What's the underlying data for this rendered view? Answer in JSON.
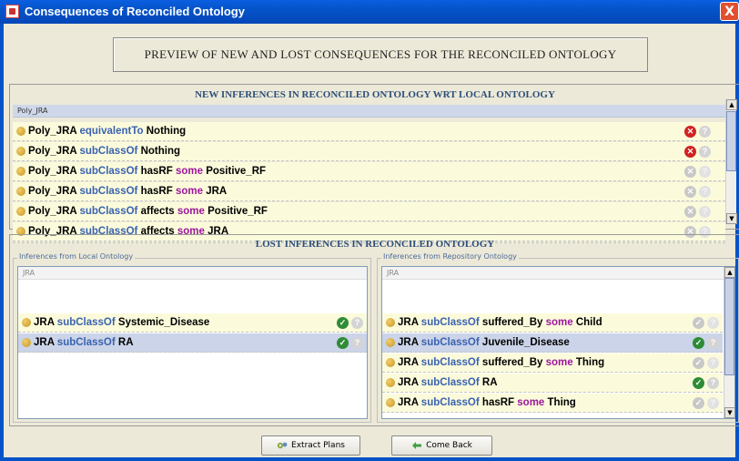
{
  "window": {
    "title": "Consequences of Reconciled Ontology",
    "close_label": "X"
  },
  "banner": "PREVIEW OF NEW AND LOST CONSEQUENCES FOR THE RECONCILED ONTOLOGY",
  "new_section": {
    "title": "NEW INFERENCES IN RECONCILED ONTOLOGY WRT LOCAL ONTOLOGY",
    "header": "Poly_JRA",
    "rows": [
      {
        "subject": "Poly_JRA",
        "rel": "equivalentTo",
        "mid": "",
        "q": "",
        "obj": "Nothing",
        "status": "x"
      },
      {
        "subject": "Poly_JRA",
        "rel": "subClassOf",
        "mid": "",
        "q": "",
        "obj": "Nothing",
        "status": "x"
      },
      {
        "subject": "Poly_JRA",
        "rel": "subClassOf",
        "mid": "hasRF",
        "q": "some",
        "obj": "Positive_RF",
        "status": "xg"
      },
      {
        "subject": "Poly_JRA",
        "rel": "subClassOf",
        "mid": "hasRF",
        "q": "some",
        "obj": "JRA",
        "status": "xg"
      },
      {
        "subject": "Poly_JRA",
        "rel": "subClassOf",
        "mid": "affects",
        "q": "some",
        "obj": "Positive_RF",
        "status": "xg"
      },
      {
        "subject": "Poly_JRA",
        "rel": "subClassOf",
        "mid": "affects",
        "q": "some",
        "obj": "JRA",
        "status": "xg"
      }
    ]
  },
  "lost_section": {
    "title": "LOST INFERENCES IN RECONCILED ONTOLOGY",
    "local": {
      "label": "Inferences from Local Ontology",
      "header": "JRA",
      "rows": [
        {
          "subject": "JRA",
          "rel": "subClassOf",
          "mid": "",
          "q": "",
          "obj": "Systemic_Disease",
          "status": "chk",
          "selected": false
        },
        {
          "subject": "JRA",
          "rel": "subClassOf",
          "mid": "",
          "q": "",
          "obj": "RA",
          "status": "chk",
          "selected": true
        }
      ]
    },
    "repo": {
      "label": "Inferences from Repository Ontology",
      "header": "JRA",
      "rows": [
        {
          "subject": "JRA",
          "rel": "subClassOf",
          "mid": "suffered_By",
          "q": "some",
          "obj": "Child",
          "status": "chkg",
          "selected": false
        },
        {
          "subject": "JRA",
          "rel": "subClassOf",
          "mid": "",
          "q": "",
          "obj": "Juvenile_Disease",
          "status": "chk",
          "selected": true
        },
        {
          "subject": "JRA",
          "rel": "subClassOf",
          "mid": "suffered_By",
          "q": "some",
          "obj": "Thing",
          "status": "chkg",
          "selected": false
        },
        {
          "subject": "JRA",
          "rel": "subClassOf",
          "mid": "",
          "q": "",
          "obj": "RA",
          "status": "chk",
          "selected": false
        },
        {
          "subject": "JRA",
          "rel": "subClassOf",
          "mid": "hasRF",
          "q": "some",
          "obj": "Thing",
          "status": "chkg",
          "selected": false
        }
      ]
    }
  },
  "buttons": {
    "extract": "Extract Plans",
    "back": "Come Back"
  },
  "icons": {
    "reject": "x-circle-icon",
    "accept": "check-circle-icon",
    "explain": "question-icon",
    "bullet": "class-bullet-icon"
  },
  "colors": {
    "accent": "#0553c8",
    "row_bg": "#fbfbdc",
    "selected_row": "#cbd4e8",
    "keyword_blue": "#3a62b0",
    "keyword_purple": "#9c189c"
  }
}
